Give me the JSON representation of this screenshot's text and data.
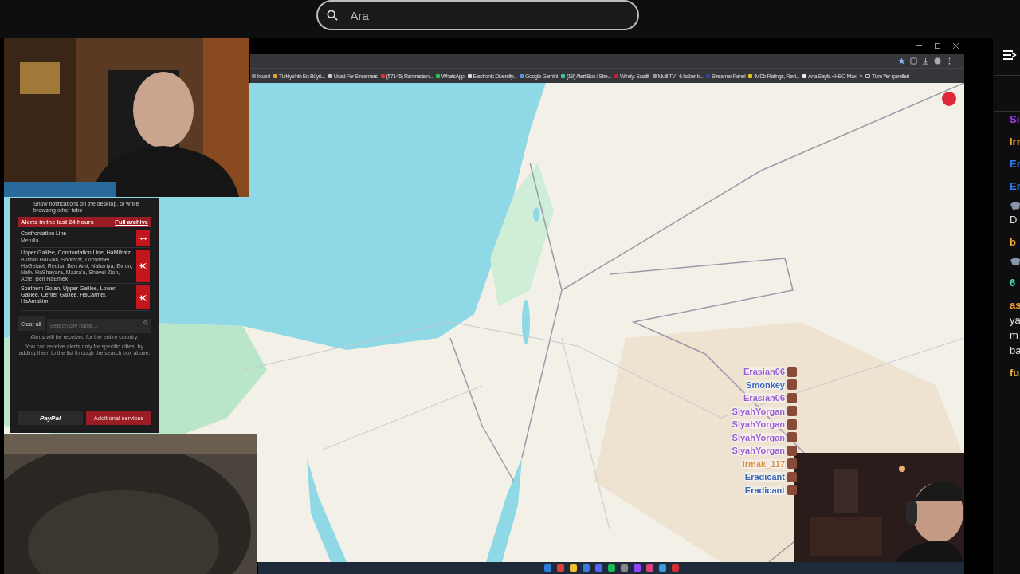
{
  "search": {
    "placeholder": "Ara"
  },
  "browser": {
    "bookmarks": [
      {
        "label": "board",
        "color": "#888888"
      },
      {
        "label": "Türkiye'nin En Büyü...",
        "color": "#e0a030"
      },
      {
        "label": "Uxad For Streamers",
        "color": "#cccccc"
      },
      {
        "label": "(57145) Rammstein...",
        "color": "#e03040"
      },
      {
        "label": "WhatsApp",
        "color": "#30c060"
      },
      {
        "label": "Electronic Diversity...",
        "color": "#dddddd"
      },
      {
        "label": "Google Gemini",
        "color": "#6090e0"
      },
      {
        "label": "(19) Alert Box / Stre...",
        "color": "#40c0a0"
      },
      {
        "label": "Windy: Scattit",
        "color": "#c02040"
      },
      {
        "label": "Multi TV - 6 haber k...",
        "color": "#999999"
      },
      {
        "label": "Streamer Panel",
        "color": "#3040a0"
      },
      {
        "label": "IMDb Ratings, Revi...",
        "color": "#e8c020"
      },
      {
        "label": "Ana Sayfa • HBO Max",
        "color": "#eeeeee"
      }
    ],
    "more": "»",
    "all_bookmarks": "Tüm Yer İşaretleri"
  },
  "alerts_panel": {
    "notice": "Show notifications on the desktop, or while browsing other tabs",
    "header": "Alerts in the last 24 hours",
    "archive_link": "Full archive",
    "alerts": [
      {
        "kind": "drone",
        "areas": "Confrontation Line",
        "cities": "Metulla"
      },
      {
        "kind": "missile",
        "areas": "Upper Galilee, Confrontation Line, HaMifratz",
        "cities": "Bustan HaGalil, Shomrat, Lochamei HaGetaot, Regba, Ben Ami, Nahariya, Evron, Nativ HaShayara, Mazra'a, Shavei Zion, Acre, Beit HaEmek"
      },
      {
        "kind": "missile",
        "areas": "Southern Golan, Upper Galilee, Lower Galilee, Center Galilee, HaCarmel, HaAmakim"
      }
    ],
    "clear_button": "Clear all",
    "search_placeholder": "Search city name...",
    "info": "Alerts will be received for the entire country.",
    "hint": "You can receive alerts only for specific cities, by adding them to the list through the search box above.",
    "paypal": "PayPal",
    "services_button": "Additional services"
  },
  "chat_overlay": [
    {
      "name": "Erasian06",
      "color": "#9a5cd0"
    },
    {
      "name": "Smonkey",
      "color": "#3a64b8"
    },
    {
      "name": "Erasian06",
      "color": "#9a5cd0"
    },
    {
      "name": "SiyahYorgan",
      "color": "#9a5cd0"
    },
    {
      "name": "SiyahYorgan",
      "color": "#9a5cd0"
    },
    {
      "name": "SiyahYorgan",
      "color": "#9a5cd0"
    },
    {
      "name": "SiyahYorgan",
      "color": "#9a5cd0"
    },
    {
      "name": "Irmak_117",
      "color": "#d89040"
    },
    {
      "name": "Eradicant",
      "color": "#3a64b8"
    },
    {
      "name": "Eradicant",
      "color": "#3a64b8"
    }
  ],
  "side_chat": [
    {
      "kind": "name",
      "text": "Si",
      "color": "#9b3ff0"
    },
    {
      "kind": "name",
      "text": "Irr",
      "color": "#f0a030"
    },
    {
      "kind": "name",
      "text": "Er",
      "color": "#2f7df0"
    },
    {
      "kind": "name",
      "text": "Er",
      "color": "#2f7df0"
    },
    {
      "kind": "emote"
    },
    {
      "kind": "message",
      "text": "D"
    },
    {
      "kind": "name",
      "text": "b",
      "color": "#f0b030"
    },
    {
      "kind": "emote"
    },
    {
      "kind": "name",
      "text": "6",
      "color": "#40e0b0"
    },
    {
      "kind": "name",
      "text": "as",
      "color": "#f0a030"
    },
    {
      "kind": "message",
      "text": "ya"
    },
    {
      "kind": "message",
      "text": "m"
    },
    {
      "kind": "message",
      "text": "ba"
    },
    {
      "kind": "name",
      "text": "fu",
      "color": "#f0b030"
    }
  ]
}
